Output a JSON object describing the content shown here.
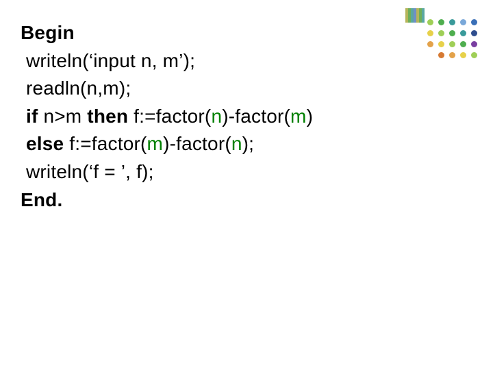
{
  "code": {
    "l1_begin": "Begin",
    "l2": " writeln(‘input n, m’);",
    "l3": " readln(n,m);",
    "l4_if": " if",
    "l4_mid1": " n>m ",
    "l4_then": "then",
    "l4_mid2": " f:=factor(",
    "l4_n1": "n",
    "l4_mid3": ")-factor(",
    "l4_m1": "m",
    "l4_end": ")",
    "l5_else": " else",
    "l5_mid1": " f:=factor(",
    "l5_m": "m",
    "l5_mid2": ")-factor(",
    "l5_n": "n",
    "l5_end": ");",
    "l6": " writeln(‘f = ’, f);",
    "l7_end": "End."
  }
}
